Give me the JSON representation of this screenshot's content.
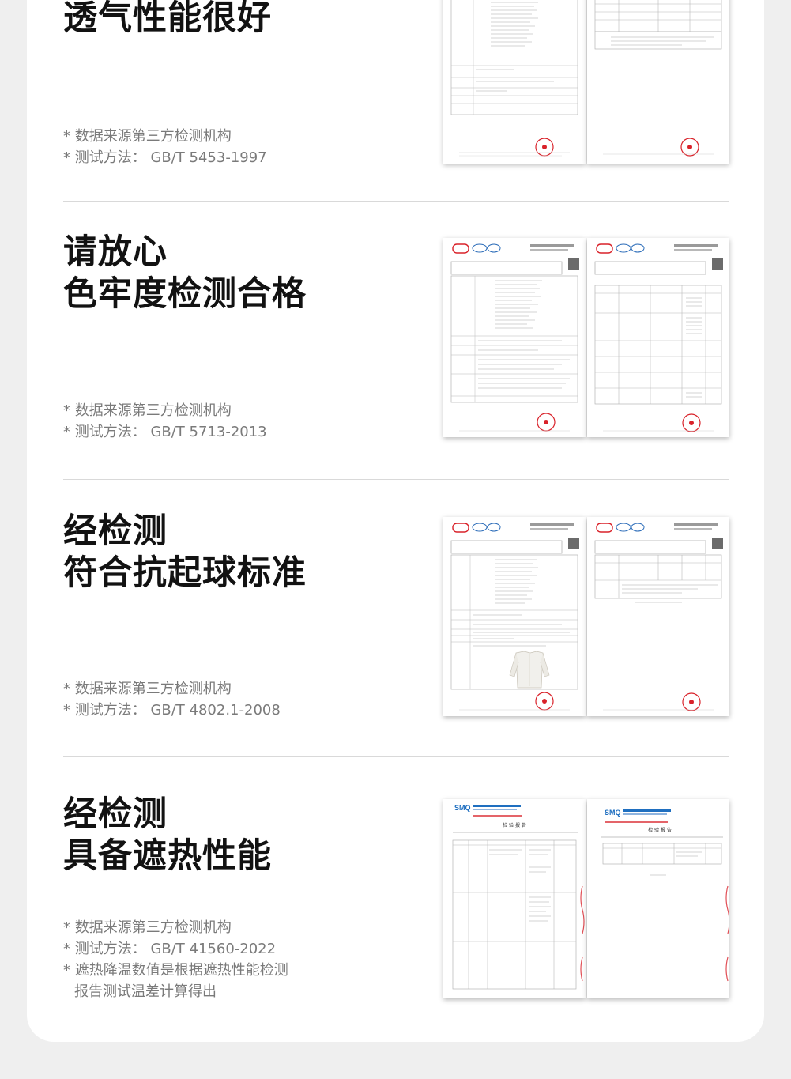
{
  "sections": [
    {
      "title_lines": [
        "透气性能很好"
      ],
      "notes": [
        "* 数据来源第三方检测机构",
        "* 测试方法：  GB/T 5453-1997"
      ]
    },
    {
      "title_lines": [
        "请放心",
        "色牢度检测合格"
      ],
      "notes": [
        "* 数据来源第三方检测机构",
        "* 测试方法：  GB/T 5713-2013"
      ]
    },
    {
      "title_lines": [
        "经检测",
        "符合抗起球标准"
      ],
      "notes": [
        "* 数据来源第三方检测机构",
        "* 测试方法：  GB/T 4802.1-2008"
      ]
    },
    {
      "title_lines": [
        "经检测",
        "具备遮热性能"
      ],
      "notes": [
        "* 数据来源第三方检测机构",
        "* 测试方法：  GB/T 41560-2022",
        "* 遮热降温数值是根据遮热性能检测",
        "报告测试温差计算得出"
      ]
    }
  ],
  "report_labels": {
    "smq": "SMQ",
    "inspection_report": "检 验 报 告"
  },
  "colors": {
    "title": "#121212",
    "note": "#7a7a7a",
    "stamp": "#d9222a",
    "smq_blue": "#1f6fc0"
  }
}
